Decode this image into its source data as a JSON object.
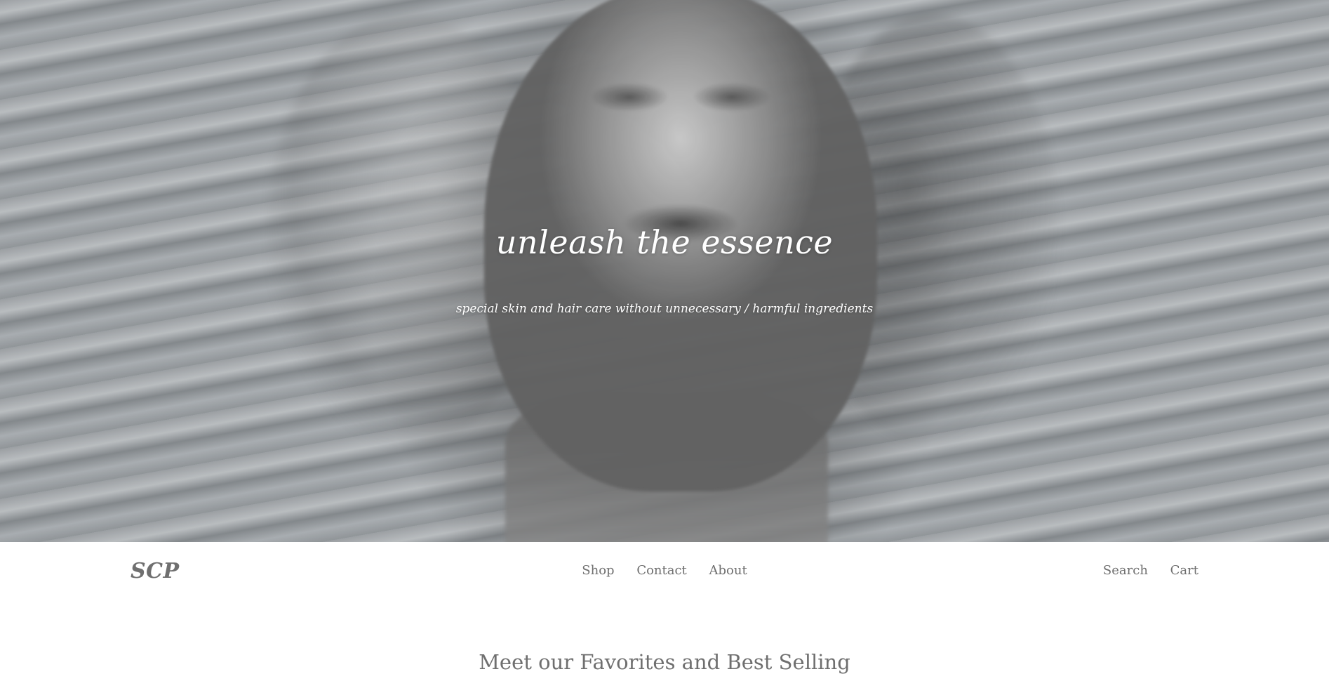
{
  "hero": {
    "title": "unleash the essence",
    "subtitle": "special skin and hair care without unnecessary / harmful ingredients"
  },
  "header": {
    "logo": "SCP",
    "nav": {
      "shop": "Shop",
      "contact": "Contact",
      "about": "About"
    },
    "actions": {
      "search": "Search",
      "cart": "Cart"
    }
  },
  "section": {
    "heading": "Meet our Favorites and Best Selling"
  },
  "colors": {
    "text": "#6f6f6f",
    "background": "#ffffff",
    "hero_text": "#ffffff"
  }
}
